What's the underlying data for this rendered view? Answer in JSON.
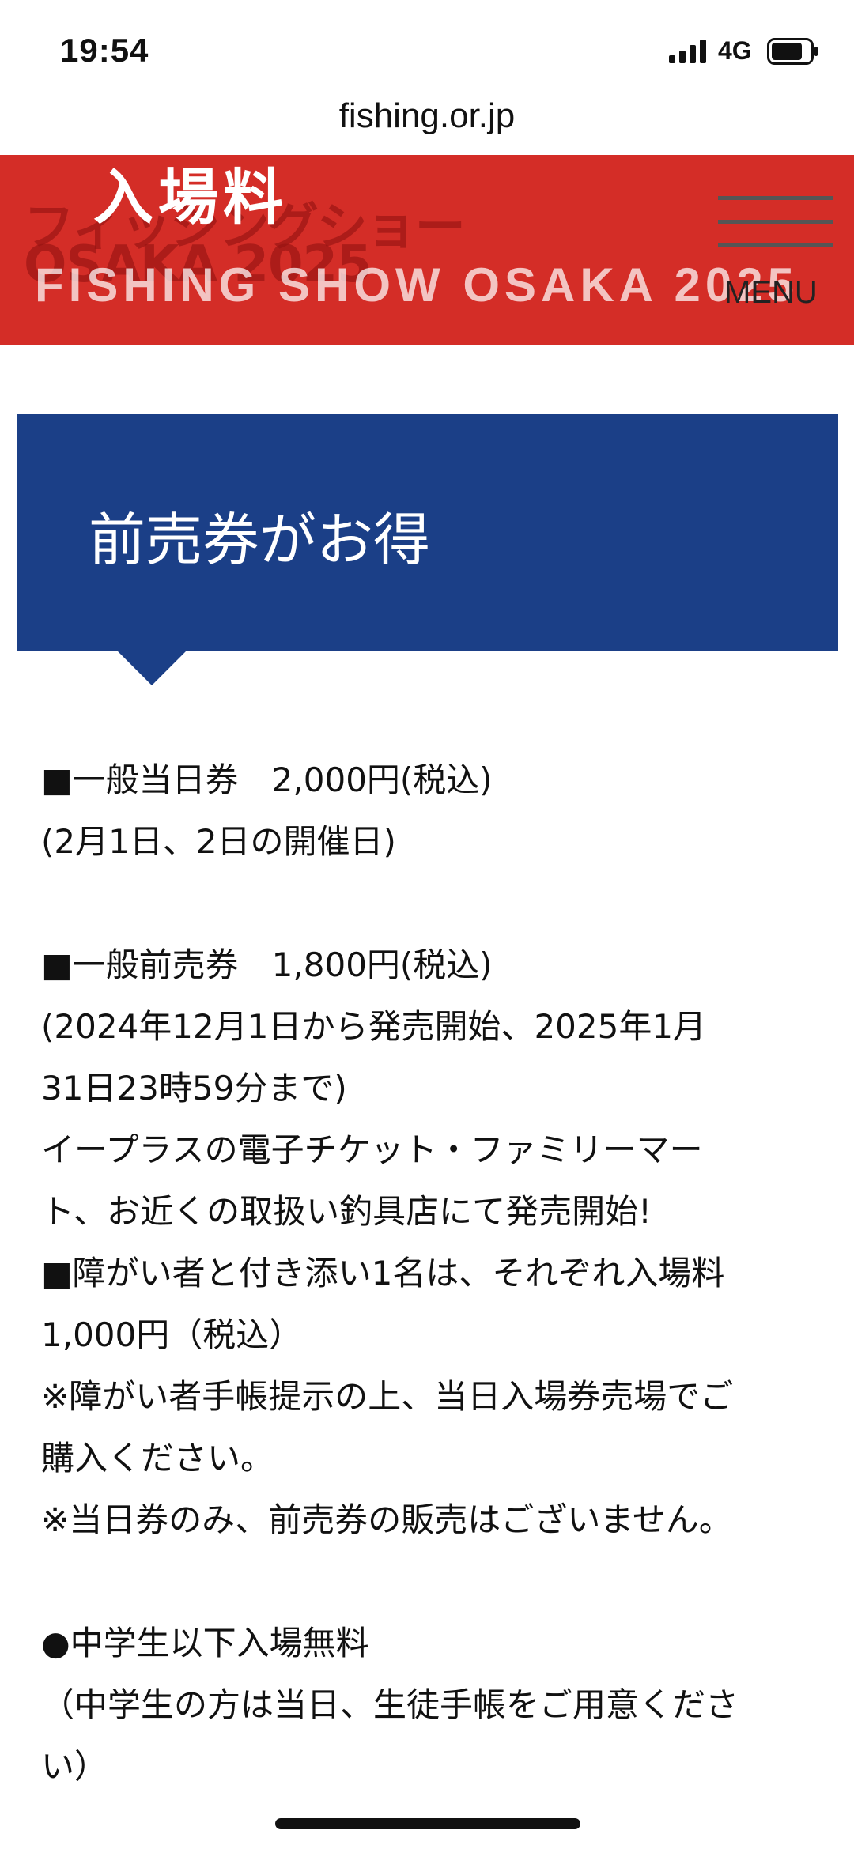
{
  "status": {
    "time": "19:54",
    "network": "4G"
  },
  "browser": {
    "url": "fishing.or.jp"
  },
  "header": {
    "title": "入場料",
    "logo_ja": "フィッシングショー",
    "logo_en": "OSAKA 2025",
    "event_name": "FISHING SHOW OSAKA 2025",
    "menu_label": "MENU"
  },
  "section": {
    "title": "前売券がお得"
  },
  "content": {
    "line1": "■一般当日券　2,000円(税込)",
    "line2": "(2月1日、2日の開催日)",
    "line3": "■一般前売券　1,800円(税込)",
    "line4": "(2024年12月1日から発売開始、2025年1月",
    "line5": "31日23時59分まで)",
    "line6": "イープラスの電子チケット・ファミリーマー",
    "line7": "ト、お近くの取扱い釣具店にて発売開始!",
    "line8": "■障がい者と付き添い1名は、それぞれ入場料",
    "line9": "1,000円（税込）",
    "line10": "※障がい者手帳提示の上、当日入場券売場でご",
    "line11": "購入ください。",
    "line12": "※当日券のみ、前売券の販売はございません。",
    "line13": "●中学生以下入場無料",
    "line14": "（中学生の方は当日、生徒手帳をご用意くださ",
    "line15": "い）"
  },
  "colors": {
    "header_red": "#d42d27",
    "section_blue": "#1b3f87"
  }
}
